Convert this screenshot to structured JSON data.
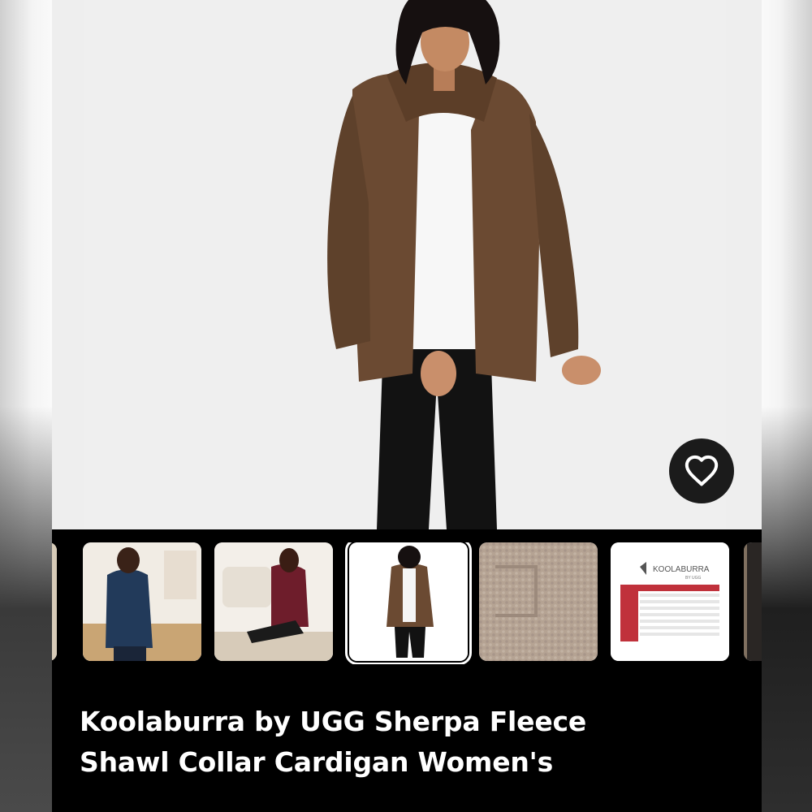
{
  "product": {
    "title_line1": "Koolaburra by UGG Sherpa Fleece",
    "title_line2": "Shawl Collar Cardigan Women's"
  },
  "hero": {
    "image": "model-in-brown-sherpa-cardigan"
  },
  "favorite": {
    "icon": "heart-outline-icon"
  },
  "thumbnails": [
    {
      "name": "partial-prev-thumb"
    },
    {
      "name": "navy-cardigan-thumb"
    },
    {
      "name": "burgundy-cardigan-thumb"
    },
    {
      "name": "brown-cardigan-thumb",
      "selected": true
    },
    {
      "name": "sherpa-texture-thumb"
    },
    {
      "name": "size-chart-thumb",
      "brand": "KOOLABURRA",
      "sub": "BY UGG"
    },
    {
      "name": "partial-next-thumb"
    }
  ],
  "colors": {
    "jacket": "#6b4a32",
    "panel": "#000000",
    "title": "#ffffff",
    "chart_accent": "#c0313b"
  }
}
